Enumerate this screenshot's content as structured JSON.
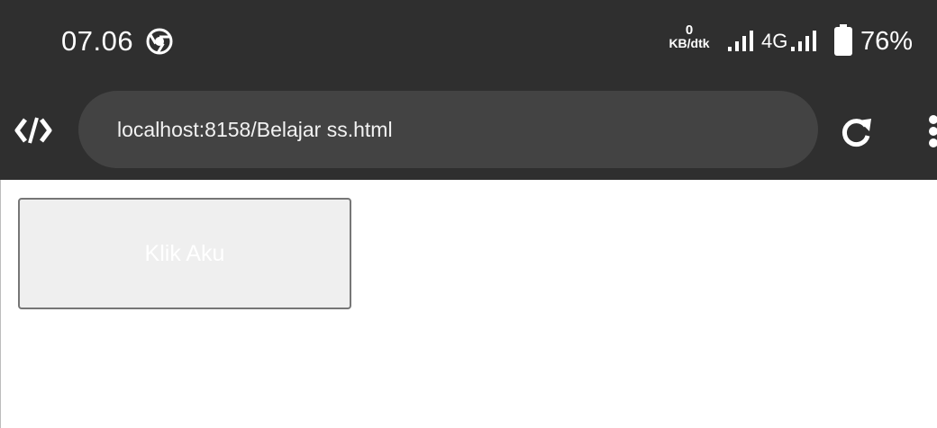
{
  "status_bar": {
    "time": "07.06",
    "app_icon": "chrome-icon",
    "net_speed_value": "0",
    "net_speed_unit": "KB/dtk",
    "network_type": "4G",
    "battery_percent": "76%",
    "background_color": "#2f2f2f"
  },
  "toolbar": {
    "left_icon": "dev-tools-icon",
    "url": "localhost:8158/Belajar ss.html",
    "reload_icon": "reload-icon",
    "menu_icon": "more-vert-icon",
    "url_bar_color": "#434343"
  },
  "page": {
    "button_label": "Klik Aku",
    "button_background": "#efefef",
    "button_text_color": "#ffffff"
  }
}
